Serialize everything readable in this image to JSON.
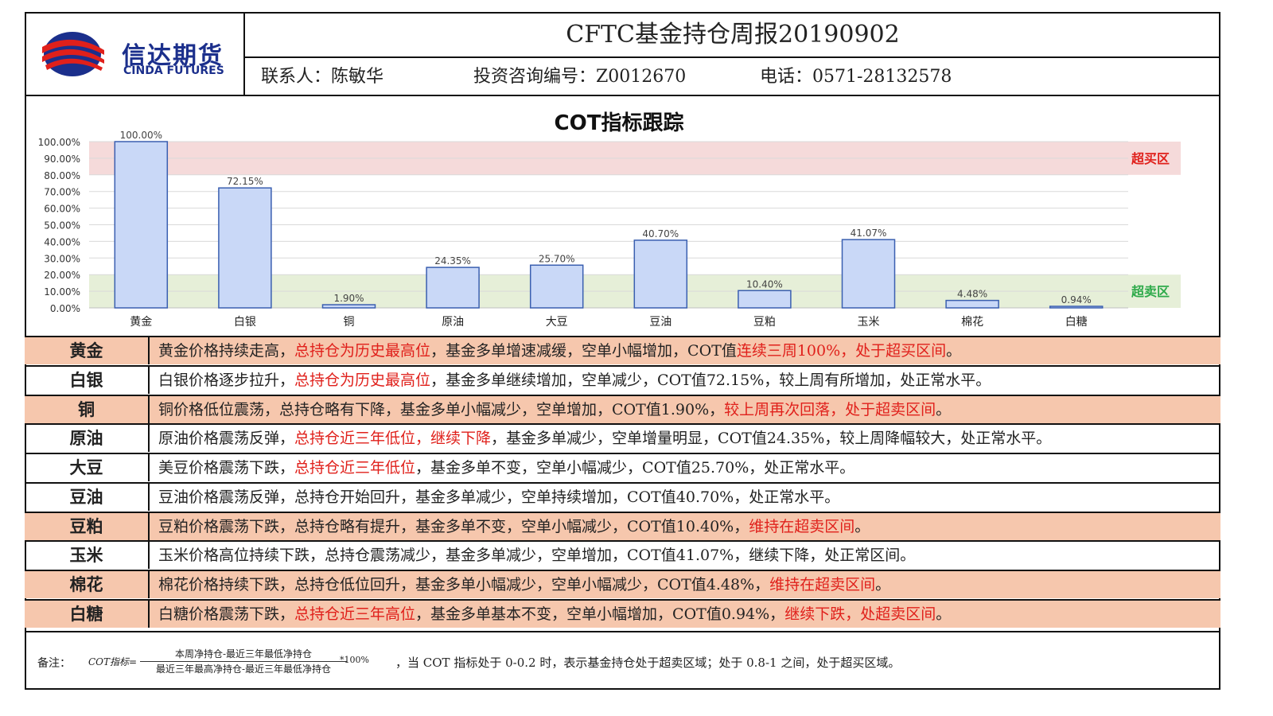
{
  "header": {
    "logo_cn": "信达期货",
    "logo_en": "CINDA FUTURES",
    "title": "CFTC基金持仓周报20190902",
    "contact_label": "联系人：陈敏华",
    "license_label": "投资咨询编号：Z0012670",
    "phone_label": "电话：0571-28132578"
  },
  "chart_data": {
    "type": "bar",
    "title": "COT指标跟踪",
    "categories": [
      "黄金",
      "白银",
      "铜",
      "原油",
      "大豆",
      "豆油",
      "豆粕",
      "玉米",
      "棉花",
      "白糖"
    ],
    "values": [
      100.0,
      72.15,
      1.9,
      24.35,
      25.7,
      40.7,
      10.4,
      41.07,
      4.48,
      0.94
    ],
    "value_labels": [
      "100.00%",
      "72.15%",
      "1.90%",
      "24.35%",
      "25.70%",
      "40.70%",
      "10.40%",
      "41.07%",
      "4.48%",
      "0.94%"
    ],
    "ylim": [
      0,
      100
    ],
    "y_ticks": [
      "0.00%",
      "10.00%",
      "20.00%",
      "30.00%",
      "40.00%",
      "50.00%",
      "60.00%",
      "70.00%",
      "80.00%",
      "90.00%",
      "100.00%"
    ],
    "grid": true,
    "zones": [
      {
        "label": "超买区",
        "range": [
          80,
          100
        ],
        "color": "#f5dada",
        "label_color": "#e0201b"
      },
      {
        "label": "超卖区",
        "range": [
          0,
          20
        ],
        "color": "#e6efd8",
        "label_color": "#2eaa4a"
      }
    ],
    "bar_color": "#c9d8f7",
    "bar_border": "#3a5fb0"
  },
  "rows": [
    {
      "name": "黄金",
      "highlight": true,
      "segments": [
        {
          "t": "黄金价格持续走高，",
          "red": false
        },
        {
          "t": "总持仓为历史最高位",
          "red": true
        },
        {
          "t": "，基金多单增速减缓，空单小幅增加，COT值",
          "red": false
        },
        {
          "t": "连续三周100%，处于超买区间",
          "red": true
        },
        {
          "t": "。",
          "red": false
        }
      ]
    },
    {
      "name": "白银",
      "highlight": false,
      "segments": [
        {
          "t": "白银价格逐步拉升，",
          "red": false
        },
        {
          "t": "总持仓为历史最高位",
          "red": true
        },
        {
          "t": "，基金多单继续增加，空单减少，COT值72.15%，较上周有所增加，处正常水平。",
          "red": false
        }
      ]
    },
    {
      "name": "铜",
      "highlight": true,
      "segments": [
        {
          "t": "铜价格低位震荡，总持仓略有下降，基金多单小幅减少，空单增加，COT值1.90%，",
          "red": false
        },
        {
          "t": "较上周再次回落，处于超卖区间",
          "red": true
        },
        {
          "t": "。",
          "red": false
        }
      ]
    },
    {
      "name": "原油",
      "highlight": false,
      "segments": [
        {
          "t": "原油价格震荡反弹，",
          "red": false
        },
        {
          "t": "总持仓近三年低位，继续下降",
          "red": true
        },
        {
          "t": "，基金多单减少，空单增量明显，COT值24.35%，较上周降幅较大，处正常水平。",
          "red": false
        }
      ]
    },
    {
      "name": "大豆",
      "highlight": false,
      "segments": [
        {
          "t": "美豆价格震荡下跌，",
          "red": false
        },
        {
          "t": "总持仓近三年低位",
          "red": true
        },
        {
          "t": "，基金多单不变，空单小幅减少，COT值25.70%，处正常水平。",
          "red": false
        }
      ]
    },
    {
      "name": "豆油",
      "highlight": false,
      "segments": [
        {
          "t": "豆油价格震荡反弹，总持仓开始回升，基金多单减少，空单持续增加，COT值40.70%，处正常水平。",
          "red": false
        }
      ]
    },
    {
      "name": "豆粕",
      "highlight": true,
      "segments": [
        {
          "t": "豆粕价格震荡下跌，总持仓略有提升，基金多单不变，空单小幅减少，COT值10.40%，",
          "red": false
        },
        {
          "t": "维持在超卖区间",
          "red": true
        },
        {
          "t": "。",
          "red": false
        }
      ]
    },
    {
      "name": "玉米",
      "highlight": false,
      "segments": [
        {
          "t": "玉米价格高位持续下跌，总持仓震荡减少，基金多单减少，空单增加，COT值41.07%，继续下降，处正常区间。",
          "red": false
        }
      ]
    },
    {
      "name": "棉花",
      "highlight": true,
      "segments": [
        {
          "t": "棉花价格持续下跌，总持仓低位回升，基金多单小幅减少，空单小幅减少，COT值4.48%，",
          "red": false
        },
        {
          "t": "维持在超卖区间",
          "red": true
        },
        {
          "t": "。",
          "red": false
        }
      ]
    },
    {
      "name": "白糖",
      "highlight": true,
      "segments": [
        {
          "t": "白糖价格震荡下跌，",
          "red": false
        },
        {
          "t": "总持仓近三年高位",
          "red": true
        },
        {
          "t": "，基金多单基本不变，空单小幅增加，COT值0.94%，",
          "red": false
        },
        {
          "t": "继续下跌，处超卖区间",
          "red": true
        },
        {
          "t": "。",
          "red": false
        }
      ]
    }
  ],
  "note": {
    "label": "备注：",
    "formula_name": "COT指标=",
    "numerator": "本周净持仓-最近三年最低净持仓",
    "denominator": "最近三年最高净持仓-最近三年最低净持仓",
    "multiplier": "*100%",
    "text": "，当 COT 指标处于 0-0.2 时，表示基金持仓处于超卖区域；处于 0.8-1 之间，处于超买区域。"
  }
}
